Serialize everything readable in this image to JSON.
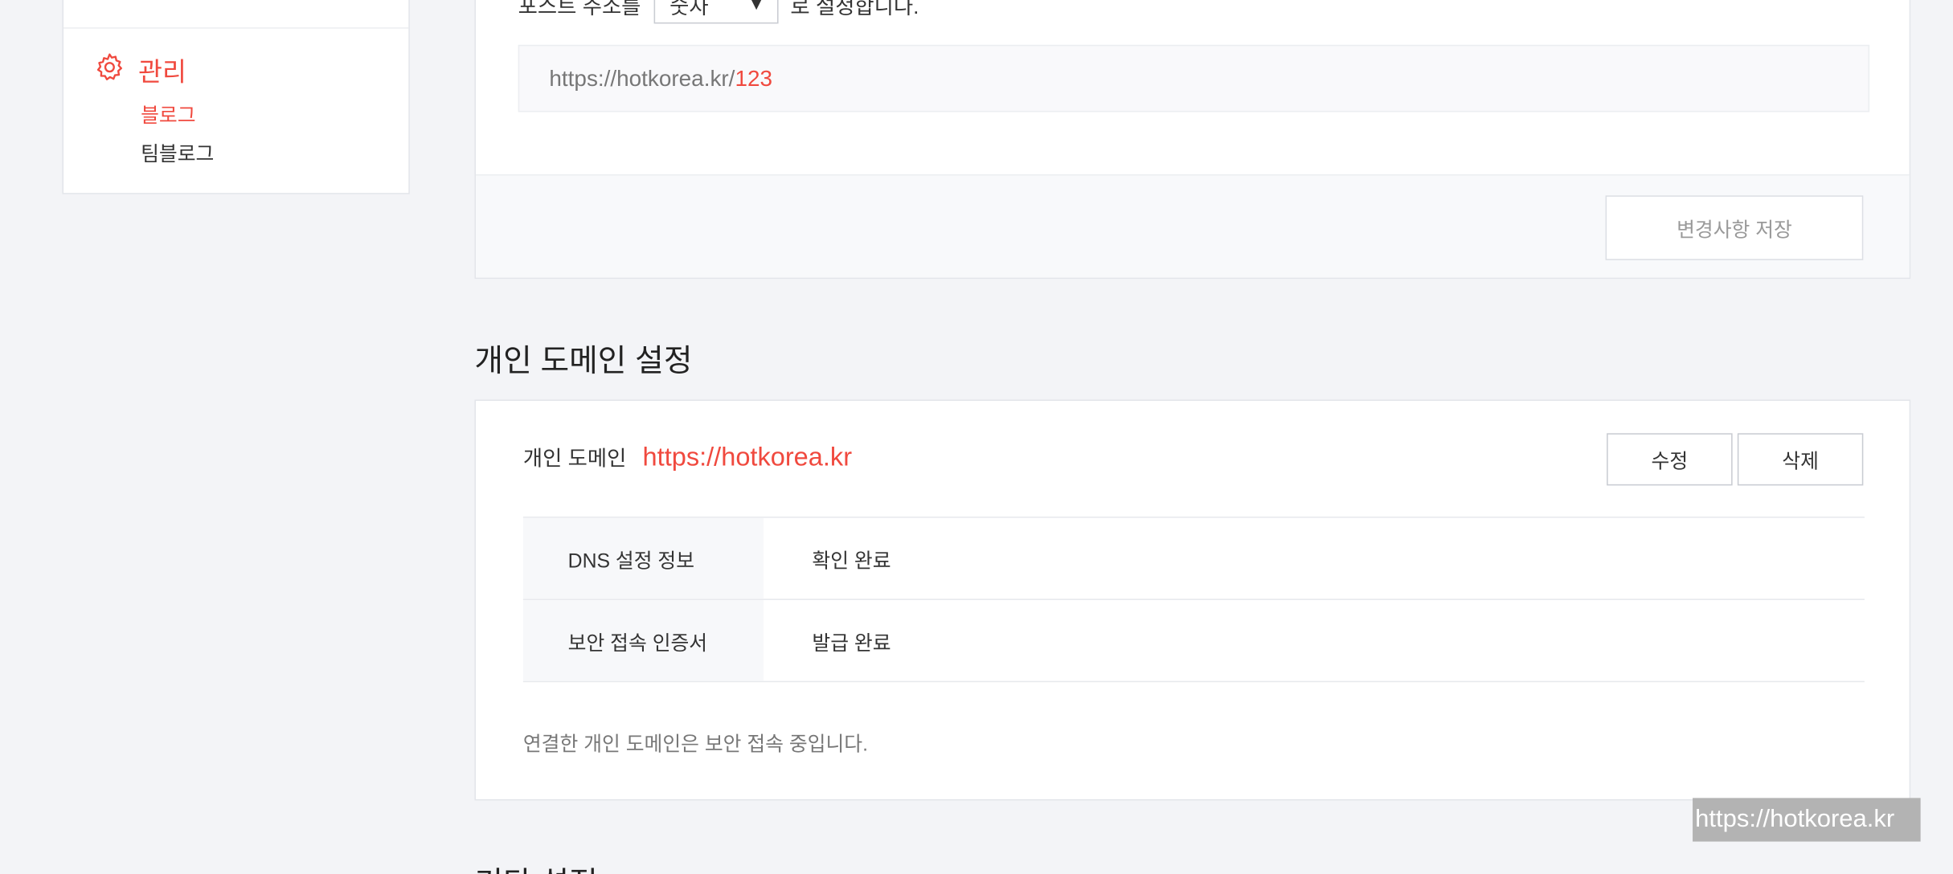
{
  "sidebar": {
    "section_label": "관리",
    "items": [
      {
        "label": "블로그",
        "active": true
      },
      {
        "label": "팀블로그",
        "active": false
      }
    ]
  },
  "post_address": {
    "prefix_text": "포스트 주소를",
    "selected": "숫자",
    "suffix_text": "로 설정합니다.",
    "preview_base": "https://hotkorea.kr/",
    "preview_id": "123",
    "save_button": "변경사항 저장"
  },
  "custom_domain": {
    "title": "개인 도메인 설정",
    "label": "개인 도메인",
    "url": "https://hotkorea.kr",
    "edit_button": "수정",
    "delete_button": "삭제",
    "rows": [
      {
        "key": "DNS 설정 정보",
        "value": "확인 완료"
      },
      {
        "key": "보안 접속 인증서",
        "value": "발급 완료"
      }
    ],
    "note": "연결한 개인 도메인은 보안 접속 중입니다."
  },
  "next_section_title": "기타 설정",
  "watermark": "https://hotkorea.kr",
  "colors": {
    "accent": "#f0493e",
    "background": "#f3f4f7"
  }
}
